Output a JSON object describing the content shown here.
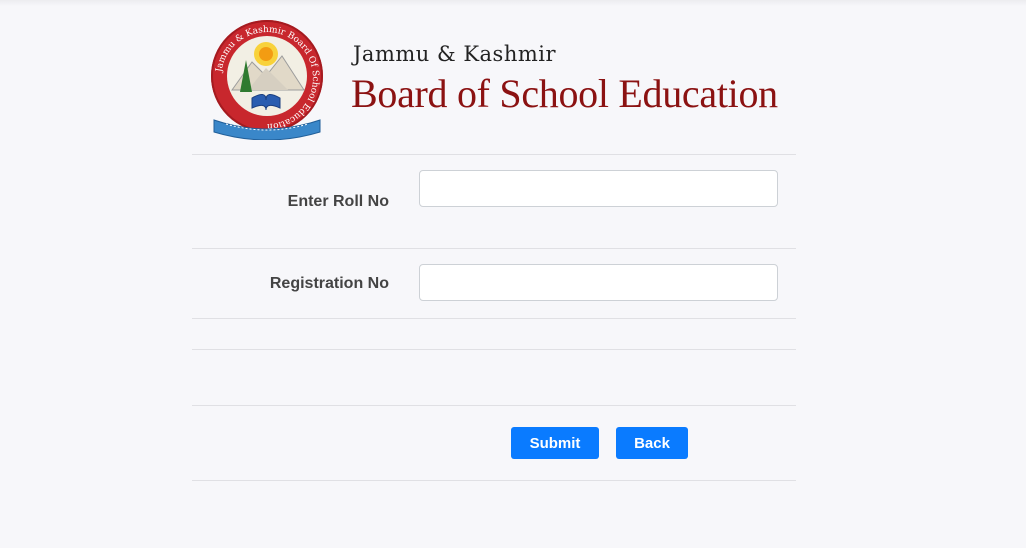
{
  "header": {
    "board_line1": "Jammu & Kashmir",
    "board_line2": "Board of School Education",
    "logo_ring_text": "Jammu & Kashmir Board Of School Education"
  },
  "form": {
    "roll_label": "Enter Roll No",
    "roll_value": "",
    "registration_label": "Registration No",
    "registration_value": "",
    "submit_label": "Submit",
    "back_label": "Back"
  },
  "colors": {
    "brand": "#8b1212",
    "button": "#0a7bff"
  }
}
